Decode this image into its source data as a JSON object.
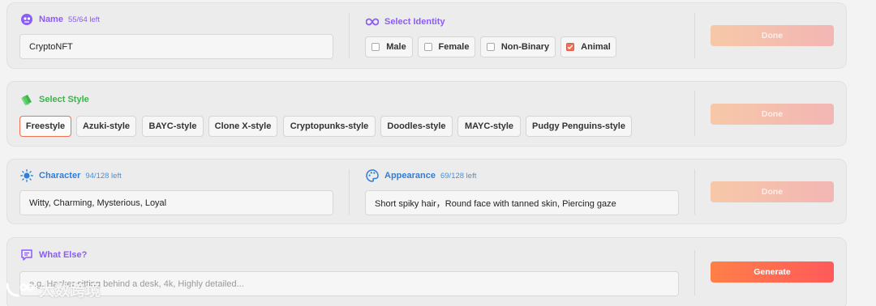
{
  "name_field": {
    "label": "Name",
    "counter": "55/64 left",
    "value": "CryptoNFT"
  },
  "identity": {
    "label": "Select Identity",
    "options": [
      {
        "label": "Male",
        "checked": false
      },
      {
        "label": "Female",
        "checked": false
      },
      {
        "label": "Non-Binary",
        "checked": false
      },
      {
        "label": "Animal",
        "checked": true
      }
    ]
  },
  "style": {
    "label": "Select Style",
    "options": [
      "Freestyle",
      "Azuki-style",
      "BAYC-style",
      "Clone X-style",
      "Cryptopunks-style",
      "Doodles-style",
      "MAYC-style",
      "Pudgy Penguins-style"
    ],
    "selected": "Freestyle"
  },
  "character": {
    "label": "Character",
    "counter": "94/128 left",
    "value": "Witty, Charming, Mysterious, Loyal"
  },
  "appearance": {
    "label": "Appearance",
    "counter": "69/128 left",
    "value": "Short spiky hair，Round face with tanned skin, Piercing gaze"
  },
  "what_else": {
    "label": "What Else?",
    "placeholder": "e.g. Hacker sitting behind a desk, 4k, Highly detailed..."
  },
  "buttons": {
    "done": "Done",
    "generate": "Generate"
  },
  "watermark": {
    "text": "大数跨境"
  },
  "colors": {
    "accent_purple": "#8b5cf6",
    "accent_green": "#3cb44b",
    "accent_blue": "#2f7ed8",
    "generate_start": "#ff7f48",
    "generate_end": "#ff5a5a"
  }
}
